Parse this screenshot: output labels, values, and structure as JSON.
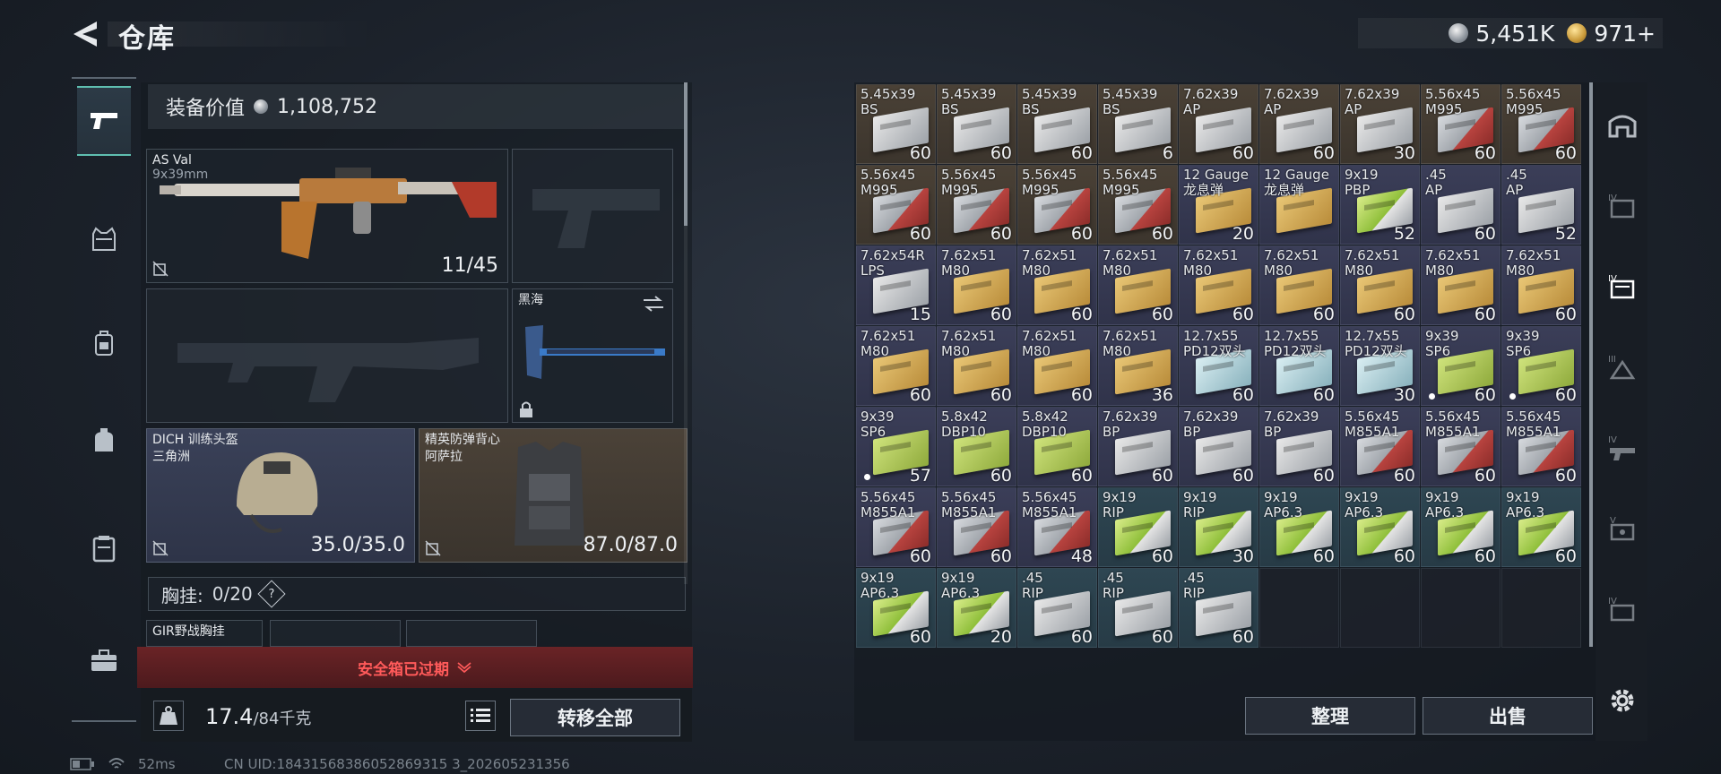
{
  "header": {
    "title": "仓库"
  },
  "currency": {
    "silver": "5,451K",
    "gold": "971+"
  },
  "loadout": {
    "equip_value_label": "装备价值",
    "equip_value": "1,108,752",
    "primary": {
      "name": "AS Val",
      "caliber": "9x39mm",
      "ammo": "11/45"
    },
    "melee": {
      "name": "黑海"
    },
    "helmet": {
      "name": "DICH 训练头盔",
      "sub": "三角洲",
      "durability": "35.0/35.0"
    },
    "armor": {
      "name": "精英防弹背心",
      "sub": "阿萨拉",
      "durability": "87.0/87.0"
    },
    "chest_rig": {
      "label": "胸挂:",
      "capacity": "0/20",
      "help": "?"
    },
    "rig_item": {
      "name": "GIR野战胸挂"
    },
    "safebox": "安全箱已过期",
    "weight": "17.4",
    "weight_max": "/84千克",
    "transfer_all": "转移全部"
  },
  "stash": {
    "sort": "整理",
    "sell": "出售",
    "items": [
      {
        "name": "5.45x39\nBS",
        "count": "60",
        "quality": "brown",
        "box": "silver"
      },
      {
        "name": "5.45x39\nBS",
        "count": "60",
        "quality": "brown",
        "box": "silver"
      },
      {
        "name": "5.45x39\nBS",
        "count": "60",
        "quality": "brown",
        "box": "silver"
      },
      {
        "name": "5.45x39\nBS",
        "count": "6",
        "quality": "brown",
        "box": "silver"
      },
      {
        "name": "7.62x39\nAP",
        "count": "60",
        "quality": "brown",
        "box": "silver"
      },
      {
        "name": "7.62x39\nAP",
        "count": "60",
        "quality": "brown",
        "box": "silver"
      },
      {
        "name": "7.62x39\nAP",
        "count": "30",
        "quality": "brown",
        "box": "silver"
      },
      {
        "name": "5.56x45\nM995",
        "count": "60",
        "quality": "brown",
        "box": "red"
      },
      {
        "name": "5.56x45\nM995",
        "count": "60",
        "quality": "brown",
        "box": "red"
      },
      {
        "name": "5.56x45\nM995",
        "count": "60",
        "quality": "brown",
        "box": "red"
      },
      {
        "name": "5.56x45\nM995",
        "count": "60",
        "quality": "brown",
        "box": "red"
      },
      {
        "name": "5.56x45\nM995",
        "count": "60",
        "quality": "brown",
        "box": "red"
      },
      {
        "name": "5.56x45\nM995",
        "count": "60",
        "quality": "brown",
        "box": "red"
      },
      {
        "name": "12 Gauge\n龙息弹",
        "count": "20",
        "quality": "purple",
        "box": "tan"
      },
      {
        "name": "12 Gauge\n龙息弹",
        "count": "",
        "quality": "purple",
        "box": "tan"
      },
      {
        "name": "9x19\nPBP",
        "count": "52",
        "quality": "purple",
        "box": "green"
      },
      {
        "name": ".45\nAP",
        "count": "60",
        "quality": "purple",
        "box": "silver"
      },
      {
        "name": ".45\nAP",
        "count": "52",
        "quality": "purple",
        "box": "silver"
      },
      {
        "name": "7.62x54R\nLPS",
        "count": "15",
        "quality": "purple",
        "box": "silver"
      },
      {
        "name": "7.62x51\nM80",
        "count": "60",
        "quality": "purple",
        "box": "tan"
      },
      {
        "name": "7.62x51\nM80",
        "count": "60",
        "quality": "purple",
        "box": "tan"
      },
      {
        "name": "7.62x51\nM80",
        "count": "60",
        "quality": "purple",
        "box": "tan"
      },
      {
        "name": "7.62x51\nM80",
        "count": "60",
        "quality": "purple",
        "box": "tan"
      },
      {
        "name": "7.62x51\nM80",
        "count": "60",
        "quality": "purple",
        "box": "tan"
      },
      {
        "name": "7.62x51\nM80",
        "count": "60",
        "quality": "purple",
        "box": "tan"
      },
      {
        "name": "7.62x51\nM80",
        "count": "60",
        "quality": "purple",
        "box": "tan"
      },
      {
        "name": "7.62x51\nM80",
        "count": "60",
        "quality": "purple",
        "box": "tan"
      },
      {
        "name": "7.62x51\nM80",
        "count": "60",
        "quality": "purple",
        "box": "tan"
      },
      {
        "name": "7.62x51\nM80",
        "count": "60",
        "quality": "purple",
        "box": "tan"
      },
      {
        "name": "7.62x51\nM80",
        "count": "60",
        "quality": "purple",
        "box": "tan"
      },
      {
        "name": "7.62x51\nM80",
        "count": "36",
        "quality": "purple",
        "box": "tan"
      },
      {
        "name": "12.7x55\nPD12双头",
        "count": "60",
        "quality": "purple",
        "box": "ice"
      },
      {
        "name": "12.7x55\nPD12双头",
        "count": "60",
        "quality": "purple",
        "box": "ice"
      },
      {
        "name": "12.7x55\nPD12双头",
        "count": "30",
        "quality": "purple",
        "box": "ice"
      },
      {
        "name": "9x39\nSP6",
        "count": "60",
        "quality": "purple",
        "box": "greygrn",
        "dot": true
      },
      {
        "name": "9x39\nSP6",
        "count": "60",
        "quality": "purple",
        "box": "greygrn",
        "dot": true
      },
      {
        "name": "9x39\nSP6",
        "count": "57",
        "quality": "purple",
        "box": "greygrn",
        "dot": true
      },
      {
        "name": "5.8x42\nDBP10",
        "count": "60",
        "quality": "purple",
        "box": "greygrn"
      },
      {
        "name": "5.8x42\nDBP10",
        "count": "60",
        "quality": "purple",
        "box": "greygrn"
      },
      {
        "name": "7.62x39\nBP",
        "count": "60",
        "quality": "purple",
        "box": "silver"
      },
      {
        "name": "7.62x39\nBP",
        "count": "60",
        "quality": "purple",
        "box": "silver"
      },
      {
        "name": "7.62x39\nBP",
        "count": "60",
        "quality": "purple",
        "box": "silver"
      },
      {
        "name": "5.56x45\nM855A1",
        "count": "60",
        "quality": "purple",
        "box": "red"
      },
      {
        "name": "5.56x45\nM855A1",
        "count": "60",
        "quality": "purple",
        "box": "red"
      },
      {
        "name": "5.56x45\nM855A1",
        "count": "60",
        "quality": "purple",
        "box": "red"
      },
      {
        "name": "5.56x45\nM855A1",
        "count": "60",
        "quality": "purple",
        "box": "red"
      },
      {
        "name": "5.56x45\nM855A1",
        "count": "60",
        "quality": "purple",
        "box": "red"
      },
      {
        "name": "5.56x45\nM855A1",
        "count": "48",
        "quality": "purple",
        "box": "red"
      },
      {
        "name": "9x19\nRIP",
        "count": "60",
        "quality": "teal",
        "box": "green"
      },
      {
        "name": "9x19\nRIP",
        "count": "30",
        "quality": "teal",
        "box": "green"
      },
      {
        "name": "9x19\nAP6.3",
        "count": "60",
        "quality": "teal",
        "box": "green"
      },
      {
        "name": "9x19\nAP6.3",
        "count": "60",
        "quality": "teal",
        "box": "green"
      },
      {
        "name": "9x19\nAP6.3",
        "count": "60",
        "quality": "teal",
        "box": "green"
      },
      {
        "name": "9x19\nAP6.3",
        "count": "60",
        "quality": "teal",
        "box": "green"
      },
      {
        "name": "9x19\nAP6.3",
        "count": "60",
        "quality": "teal",
        "box": "green"
      },
      {
        "name": "9x19\nAP6.3",
        "count": "20",
        "quality": "teal",
        "box": "green"
      },
      {
        "name": ".45\nRIP",
        "count": "60",
        "quality": "teal",
        "box": "silver"
      },
      {
        "name": ".45\nRIP",
        "count": "60",
        "quality": "teal",
        "box": "silver"
      },
      {
        "name": ".45\nRIP",
        "count": "60",
        "quality": "teal",
        "box": "silver"
      }
    ]
  },
  "footer": {
    "ping": "52ms",
    "uid": "CN UID:18431568386052869315 3_202605231356"
  }
}
